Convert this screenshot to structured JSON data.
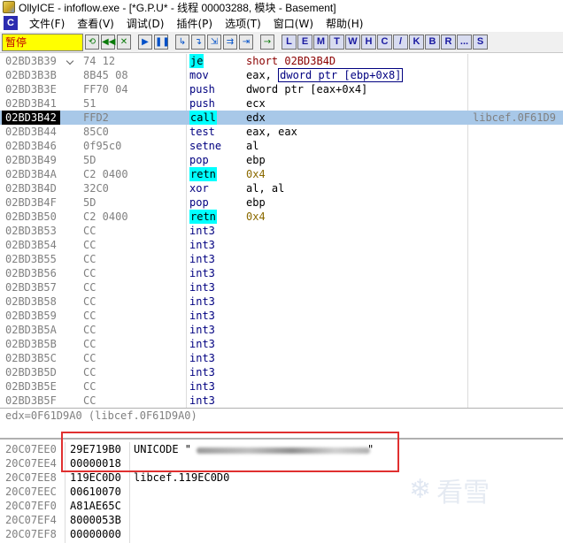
{
  "window": {
    "title": "OllyICE - infoflow.exe - [*G.P.U* -  线程 00003288, 模块 - Basement]"
  },
  "menu": {
    "sys_label": "C",
    "items": [
      "文件(F)",
      "查看(V)",
      "调试(D)",
      "插件(P)",
      "选项(T)",
      "窗口(W)",
      "帮助(H)"
    ]
  },
  "toolbar": {
    "status": "暂停",
    "letter_buttons": [
      "L",
      "E",
      "M",
      "T",
      "W",
      "H",
      "C",
      "/",
      "K",
      "B",
      "R",
      "...",
      "S"
    ]
  },
  "disasm": {
    "rows": [
      {
        "addr": "02BD3B39",
        "hex": "74 12",
        "op": "je",
        "arg": "short 02BD3B4D",
        "hl": true,
        "jmp": true
      },
      {
        "addr": "02BD3B3B",
        "hex": "8B45 08",
        "op": "mov",
        "arg_pre": "eax, ",
        "arg_box": "dword ptr [ebp+0x8]"
      },
      {
        "addr": "02BD3B3E",
        "hex": "FF70 04",
        "op": "push",
        "arg": "dword ptr [eax+0x4]"
      },
      {
        "addr": "02BD3B41",
        "hex": "51",
        "op": "push",
        "arg": "ecx"
      },
      {
        "addr": "02BD3B42",
        "hex": "FFD2",
        "op": "call",
        "arg": "edx",
        "hl": true,
        "sel": true,
        "comment": "libcef.0F61D9"
      },
      {
        "addr": "02BD3B44",
        "hex": "85C0",
        "op": "test",
        "arg": "eax, eax"
      },
      {
        "addr": "02BD3B46",
        "hex": "0f95c0",
        "op": "setne",
        "arg": "al"
      },
      {
        "addr": "02BD3B49",
        "hex": "5D",
        "op": "pop",
        "arg": "ebp"
      },
      {
        "addr": "02BD3B4A",
        "hex": "C2 0400",
        "op": "retn",
        "arg": "0x4",
        "hl": true
      },
      {
        "addr": "02BD3B4D",
        "hex": "32C0",
        "op": "xor",
        "arg": "al, al"
      },
      {
        "addr": "02BD3B4F",
        "hex": "5D",
        "op": "pop",
        "arg": "ebp"
      },
      {
        "addr": "02BD3B50",
        "hex": "C2 0400",
        "op": "retn",
        "arg": "0x4",
        "hl": true
      },
      {
        "addr": "02BD3B53",
        "hex": "CC",
        "op": "int3",
        "arg": ""
      },
      {
        "addr": "02BD3B54",
        "hex": "CC",
        "op": "int3",
        "arg": ""
      },
      {
        "addr": "02BD3B55",
        "hex": "CC",
        "op": "int3",
        "arg": ""
      },
      {
        "addr": "02BD3B56",
        "hex": "CC",
        "op": "int3",
        "arg": ""
      },
      {
        "addr": "02BD3B57",
        "hex": "CC",
        "op": "int3",
        "arg": ""
      },
      {
        "addr": "02BD3B58",
        "hex": "CC",
        "op": "int3",
        "arg": ""
      },
      {
        "addr": "02BD3B59",
        "hex": "CC",
        "op": "int3",
        "arg": ""
      },
      {
        "addr": "02BD3B5A",
        "hex": "CC",
        "op": "int3",
        "arg": ""
      },
      {
        "addr": "02BD3B5B",
        "hex": "CC",
        "op": "int3",
        "arg": ""
      },
      {
        "addr": "02BD3B5C",
        "hex": "CC",
        "op": "int3",
        "arg": ""
      },
      {
        "addr": "02BD3B5D",
        "hex": "CC",
        "op": "int3",
        "arg": ""
      },
      {
        "addr": "02BD3B5E",
        "hex": "CC",
        "op": "int3",
        "arg": ""
      },
      {
        "addr": "02BD3B5F",
        "hex": "CC",
        "op": "int3",
        "arg": ""
      }
    ]
  },
  "info": {
    "text": "edx=0F61D9A0 (libcef.0F61D9A0)"
  },
  "stack": {
    "rows": [
      {
        "addr": "20C07EE0",
        "val": "29E719B0",
        "comment": "UNICODE \"",
        "tail": "\"",
        "redacted": true
      },
      {
        "addr": "20C07EE4",
        "val": "00000018",
        "comment": ""
      },
      {
        "addr": "20C07EE8",
        "val": "119EC0D0",
        "comment": "libcef.119EC0D0"
      },
      {
        "addr": "20C07EEC",
        "val": "00610070",
        "comment": ""
      },
      {
        "addr": "20C07EF0",
        "val": "A81AE65C",
        "comment": ""
      },
      {
        "addr": "20C07EF4",
        "val": "8000053B",
        "comment": ""
      },
      {
        "addr": "20C07EF8",
        "val": "00000000",
        "comment": ""
      }
    ]
  },
  "watermark": {
    "text": "看雪"
  }
}
